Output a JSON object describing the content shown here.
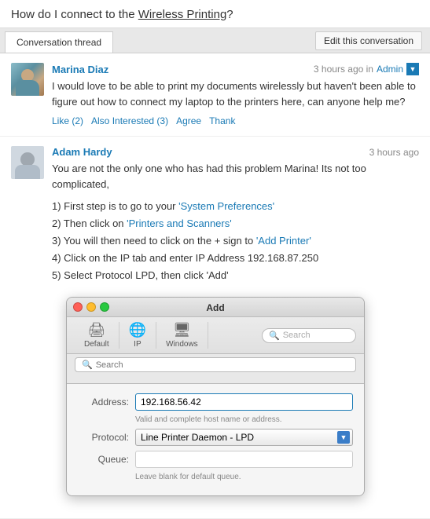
{
  "page": {
    "title_parts": [
      "How do I connect to the ",
      "Wireless Printing",
      "?"
    ]
  },
  "tabs": {
    "active": "Conversation thread",
    "edit_button": "Edit this conversation"
  },
  "posts": [
    {
      "id": "marina-post",
      "author": "Marina Diaz",
      "time": "3 hours ago in",
      "time_location": "Admin",
      "body": "I would love to be able to print my documents wirelessly but haven't been able to figure out how to connect my laptop to the printers here, can anyone help me?",
      "actions": [
        "Like (2)",
        "Also Interested (3)",
        "Agree",
        "Thank"
      ]
    },
    {
      "id": "adam-post",
      "author": "Adam Hardy",
      "time": "3 hours ago",
      "intro": "You are not the only one who has had this problem Marina! Its not too complicated,",
      "steps": [
        "1) First step is to go to your 'System Preferences'",
        "2) Then click on 'Printers and Scanners'",
        "3) You will then need to click on the + sign to 'Add Printer'",
        "4) Click on the IP tab and enter IP Address 192.168.87.250",
        "5) Select Protocol LPD, then click 'Add'"
      ]
    }
  ],
  "dialog": {
    "title": "Add",
    "buttons": {
      "red": "close",
      "yellow": "minimize",
      "green": "maximize"
    },
    "toolbar_items": [
      {
        "label": "Default",
        "icon": "🖨"
      },
      {
        "label": "IP",
        "icon": "🌐"
      },
      {
        "label": "Windows",
        "icon": "🖥"
      }
    ],
    "toolbar_search_placeholder": "Search",
    "search_label": "Search",
    "address_label": "Address:",
    "address_value": "192.168.56.42",
    "address_hint": "Valid and complete host name or address.",
    "protocol_label": "Protocol:",
    "protocol_value": "Line Printer Daemon - LPD",
    "queue_label": "Queue:",
    "queue_value": "",
    "queue_hint": "Leave blank for default queue."
  }
}
